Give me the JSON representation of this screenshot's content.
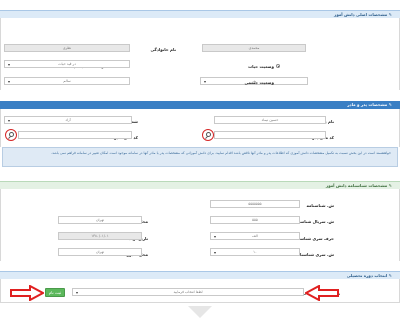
{
  "colors": {
    "blue_header": "#3a7fc4",
    "light_blue_header": "#dceaf7",
    "green_header": "#e4f1e4",
    "red_annotation": "#e02020",
    "green_button": "#5cb85c"
  },
  "section1": {
    "title": "مشخصات اصلی دانش آموز",
    "icon": "pencil-icon",
    "name_label": "نام",
    "name_value": "محمدی",
    "father_name_label": "نام خانوادگی",
    "father_name_value": "نظری",
    "gender_label": "جنسیت",
    "gender_male": "مذکر",
    "gender_female": "مونث",
    "life_status_label": "وضعیت حیات",
    "life_status_value": "در قید حیات",
    "marital_label": "وضعیت زندگی",
    "marital_value": "پدر",
    "physical_label": "وضعیت جسمی",
    "physical_value": "سالم"
  },
  "section2": {
    "title": "مشخصات پدر و مادر",
    "icon": "pencil-icon",
    "father_label": "نام پدر",
    "father_value": "حسین نیماد",
    "father_job_label": "شغل پدر",
    "father_job_value": "آزاد",
    "father_id_label": "کد ملی پدر",
    "mother_id_label": "کد ملی مادر",
    "info_text": "خواهشمند است در این بخش نسبت به تکمیل مشخصات دانش آموزی که اطلاعات پدر و مادر آنها ناقص باشد اقدام نمایید. برای دانش آموزانی که مشخصات پدر یا مادر آنها در سامانه موجود است امکان تغییر در سامانه فراهم نمی باشد."
  },
  "section3": {
    "title": "مشخصات شناسنامه دانش آموز",
    "icon": "pencil-icon",
    "id_number_label": "ش. شناسنامه",
    "id_number_value": "۵۵۵۵۵۵۵",
    "serial_label": "ش. سریال شناسنامه",
    "serial_value": "۵۵۵",
    "birthplace_label": "محل تولد",
    "birthplace_value": "تهران",
    "series_label": "حرف سری شناسنامه",
    "series_value": "الف",
    "birthdate_label": "تاریخ تولد",
    "birthdate_value": "۱۳۸۰/۰۱/۰۱",
    "series_num_label": "ش. سری شناسنامه",
    "series_num_value": "۱۰",
    "issue_place_label": "محل صدور",
    "issue_place_value": "تهران"
  },
  "section4": {
    "title": "انتخاب دوره تحصیلی",
    "icon": "pencil-icon",
    "term_label": "ترم تحصیلی ثبت نامی :",
    "term_placeholder": "لطفا انتخاب فرمایید",
    "submit_label": "ثبت نام"
  }
}
